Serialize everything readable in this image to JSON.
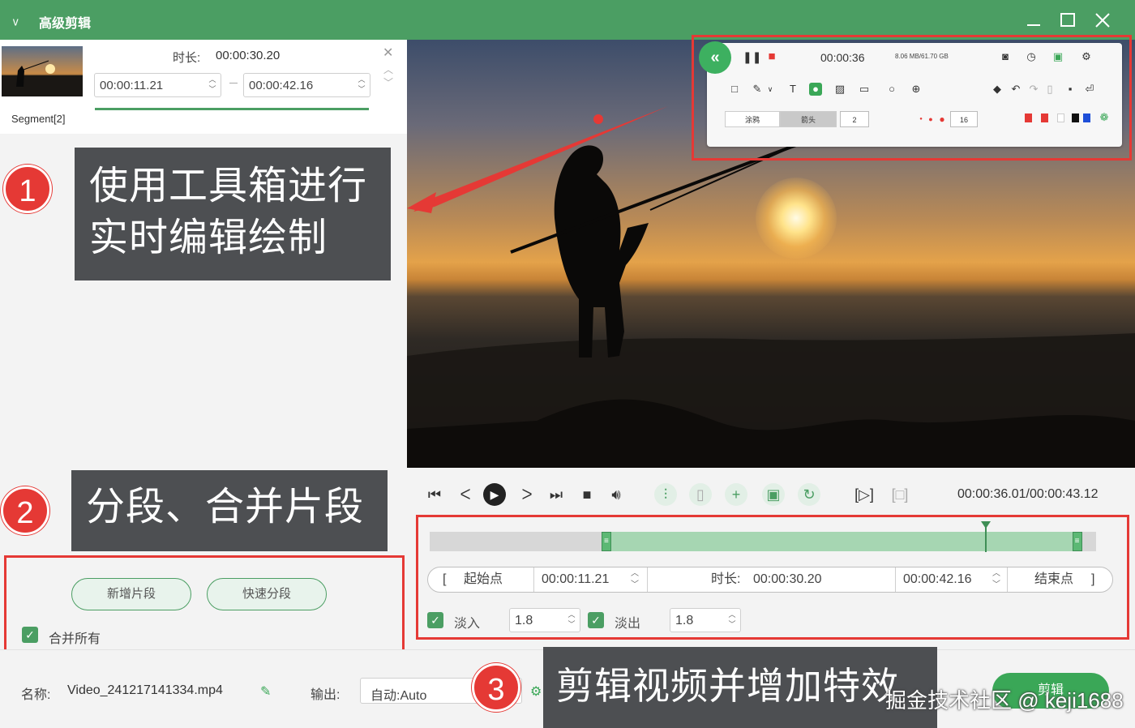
{
  "app": {
    "title": "高级剪辑"
  },
  "segment": {
    "label": "Segment[2]",
    "duration_label": "时长:",
    "duration_value": "00:00:30.20",
    "start": "00:00:11.21",
    "end": "00:00:42.16",
    "progress_fraction": 1.0
  },
  "callouts": {
    "c1_number": "1",
    "c1_line1": "使用工具箱进行",
    "c1_line2": "实时编辑绘制",
    "c2_number": "2",
    "c2_text": "分段、合并片段",
    "c3_number": "3",
    "c3_text": "剪辑视频并增加特效"
  },
  "segment_actions": {
    "add_segment": "新增片段",
    "quick_split": "快速分段",
    "merge_all_label": "合并所有",
    "merge_all_checked": true
  },
  "toolbox": {
    "time": "00:00:36",
    "size": "8.06 MB/61.70 GB",
    "seg_a": "涂鸦",
    "seg_b": "箭头",
    "width_value": "2",
    "font_value": "16",
    "colors": [
      "#e53935",
      "#e53935",
      "#ffffff",
      "#111111",
      "#1e4fd8"
    ]
  },
  "player": {
    "time_readout": "00:00:36.01/00:00:43.12",
    "playhead_fraction": 0.834,
    "sel_start_fraction": 0.2603,
    "sel_end_fraction": 0.9764
  },
  "trim": {
    "start_btn": "起始点",
    "start_value": "00:00:11.21",
    "duration_label": "时长:",
    "duration_value": "00:00:30.20",
    "end_value": "00:00:42.16",
    "end_btn": "结束点",
    "fade_in_label": "淡入",
    "fade_in_value": "1.8",
    "fade_out_label": "淡出",
    "fade_out_value": "1.8"
  },
  "bottom": {
    "name_label": "名称:",
    "name_value": "Video_241217141334.mp4",
    "output_label": "输出:",
    "output_value": "自动:Auto",
    "action_button": "剪辑"
  },
  "watermark": "掘金技术社区 @ keji1688"
}
